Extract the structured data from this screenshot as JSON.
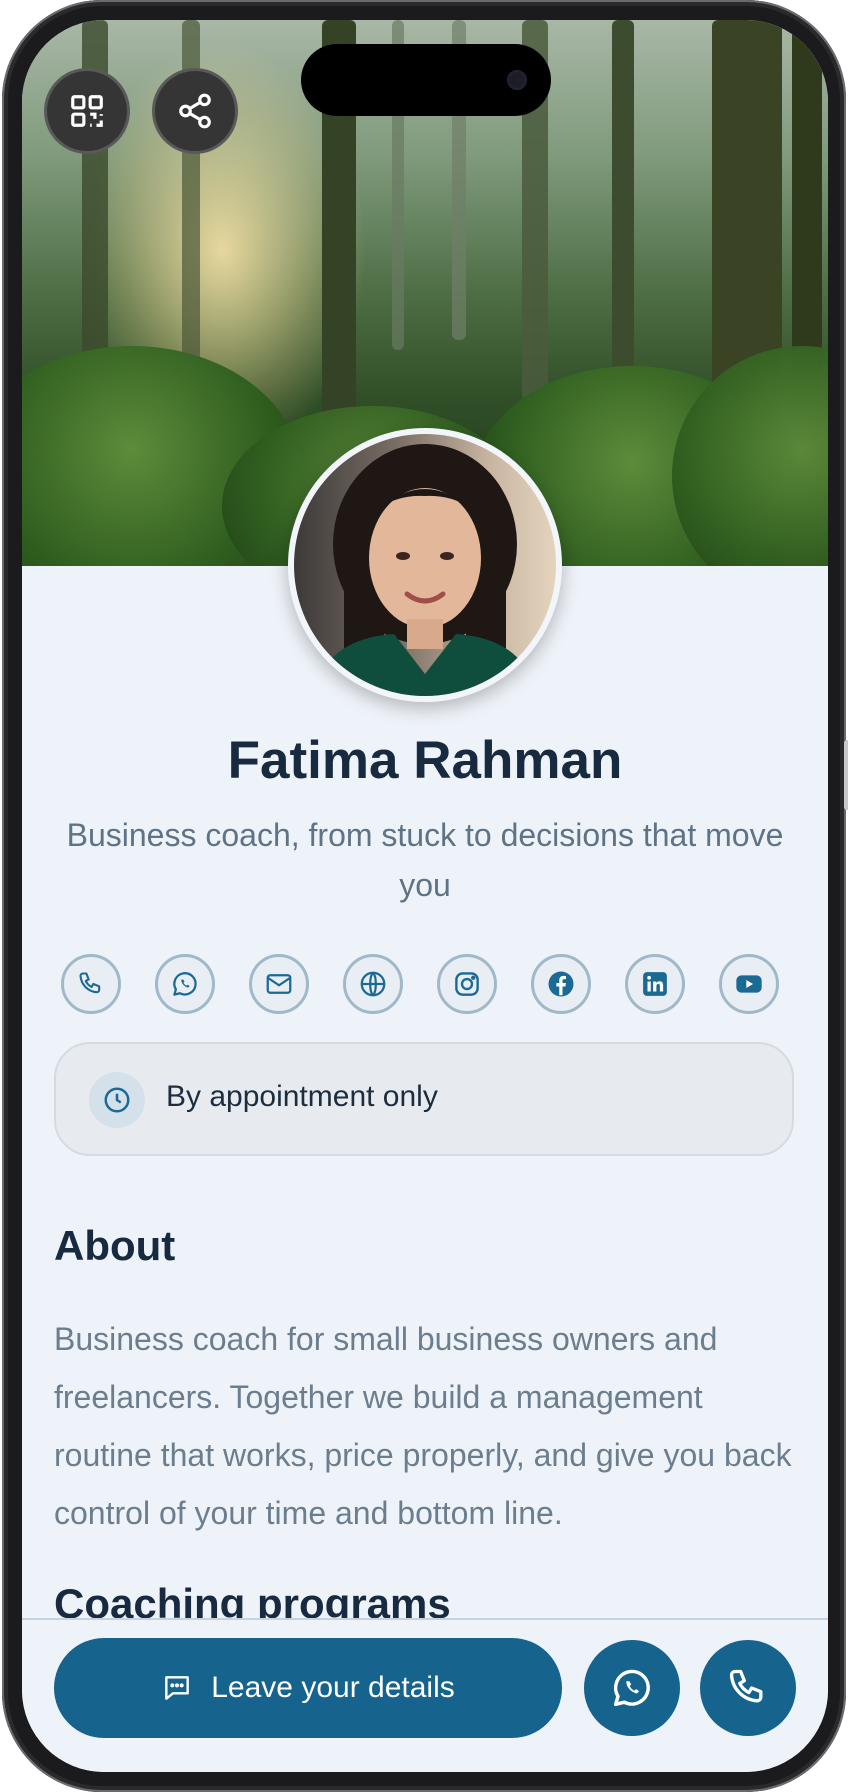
{
  "profile": {
    "name": "Fatima Rahman",
    "subtitle": "Business coach, from stuck to decisions that move you"
  },
  "top_actions": [
    {
      "icon": "qr-code-icon"
    },
    {
      "icon": "share-icon"
    }
  ],
  "social_links": [
    {
      "icon": "phone-icon"
    },
    {
      "icon": "whatsapp-icon"
    },
    {
      "icon": "mail-icon"
    },
    {
      "icon": "globe-icon"
    },
    {
      "icon": "instagram-icon"
    },
    {
      "icon": "facebook-icon"
    },
    {
      "icon": "linkedin-icon"
    },
    {
      "icon": "youtube-icon"
    }
  ],
  "hours": {
    "icon": "clock-icon",
    "text": "By appointment only"
  },
  "about": {
    "title": "About",
    "text": "Business coach for small business owners and freelancers. Together we build a management routine that works, price properly, and give you back control of your time and bottom line."
  },
  "next_section": {
    "title": "Coaching programs"
  },
  "bottom_bar": {
    "cta_label": "Leave your details",
    "cta_icon": "message-icon",
    "whatsapp_icon": "whatsapp-icon",
    "phone_icon": "phone-icon"
  },
  "colors": {
    "primary": "#16638d",
    "heading": "#172a3f",
    "body_text": "#6c7d8d",
    "background": "#eef3f9"
  }
}
